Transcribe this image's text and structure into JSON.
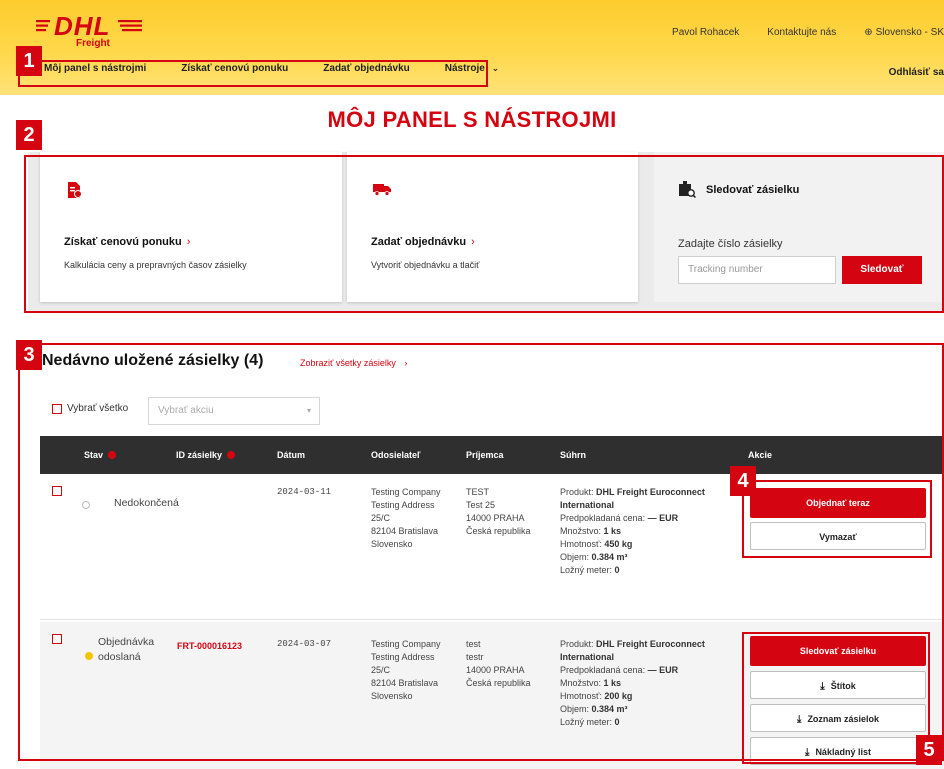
{
  "header": {
    "logo_text": "DHL",
    "logo_sub": "Freight",
    "user_name": "Pavol Rohacek",
    "contact_label": "Kontaktujte nás",
    "region_label": "Slovensko - SK",
    "logout_label": "Odhlásiť sa"
  },
  "nav": {
    "items": [
      "Môj panel s nástrojmi",
      "Získať cenovú ponuku",
      "Zadať objednávku",
      "Nástroje"
    ]
  },
  "page": {
    "title": "MÔJ PANEL S NÁSTROJMI"
  },
  "cards": [
    {
      "title": "Získať cenovú ponuku",
      "description": "Kalkulácia ceny a prepravných časov zásielky",
      "icon": "document-price-icon"
    },
    {
      "title": "Zadať objednávku",
      "description": "Vytvoriť objednávku a tlačiť",
      "icon": "truck-icon"
    }
  ],
  "tracking": {
    "title": "Sledovať zásielku",
    "label": "Zadajte číslo zásielky",
    "placeholder": "Tracking number",
    "button": "Sledovať"
  },
  "shipments": {
    "title": "Nedávno uložené zásielky (4)",
    "view_all": "Zobraziť všetky zásielky",
    "select_all": "Vybrať všetko",
    "action_placeholder": "Vybrať akciu",
    "columns": [
      "Stav",
      "ID zásielky",
      "Dátum",
      "Odosielateľ",
      "Príjemca",
      "Súhrn",
      "Akcie"
    ],
    "rows": [
      {
        "status": "Nedokončená",
        "status_color": "#bbbbbb",
        "id": "",
        "date": "2024-03-11",
        "sender": [
          "Testing Company",
          "Testing Address",
          "25/C",
          "82104 Bratislava",
          "Slovensko"
        ],
        "recipient": [
          "TEST",
          "Test 25",
          "14000 PRAHA",
          "Česká republika"
        ],
        "summary": {
          "product_label": "Produkt:",
          "product": "DHL Freight Euroconnect International",
          "price_label": "Predpokladaná cena:",
          "price": "— EUR",
          "qty_label": "Množstvo:",
          "qty": "1 ks",
          "weight_label": "Hmotnosť:",
          "weight": "450 kg",
          "volume_label": "Objem:",
          "volume": "0.384 m³",
          "ldm_label": "Ložný meter:",
          "ldm": "0"
        },
        "actions": [
          "Objednať teraz",
          "Vymazať"
        ]
      },
      {
        "status": "Objednávka odoslaná",
        "status_color": "#f5c400",
        "id": "FRT-000016123",
        "date": "2024-03-07",
        "sender": [
          "Testing Company",
          "Testing Address",
          "25/C",
          "82104 Bratislava",
          "Slovensko"
        ],
        "recipient": [
          "test",
          "testr",
          "14000 PRAHA",
          "Česká republika"
        ],
        "summary": {
          "product_label": "Produkt:",
          "product": "DHL Freight Euroconnect International",
          "price_label": "Predpokladaná cena:",
          "price": "— EUR",
          "qty_label": "Množstvo:",
          "qty": "1 ks",
          "weight_label": "Hmotnosť:",
          "weight": "200 kg",
          "volume_label": "Objem:",
          "volume": "0.384 m³",
          "ldm_label": "Ložný meter:",
          "ldm": "0"
        },
        "actions": [
          "Sledovať zásielku",
          "Štítok",
          "Zoznam zásielok",
          "Nákladný list"
        ]
      }
    ]
  },
  "annotations": [
    "1",
    "2",
    "3",
    "4",
    "5"
  ],
  "colors": {
    "brand_red": "#d40511",
    "brand_yellow": "#ffcc00",
    "table_header": "#2f2f2f"
  }
}
